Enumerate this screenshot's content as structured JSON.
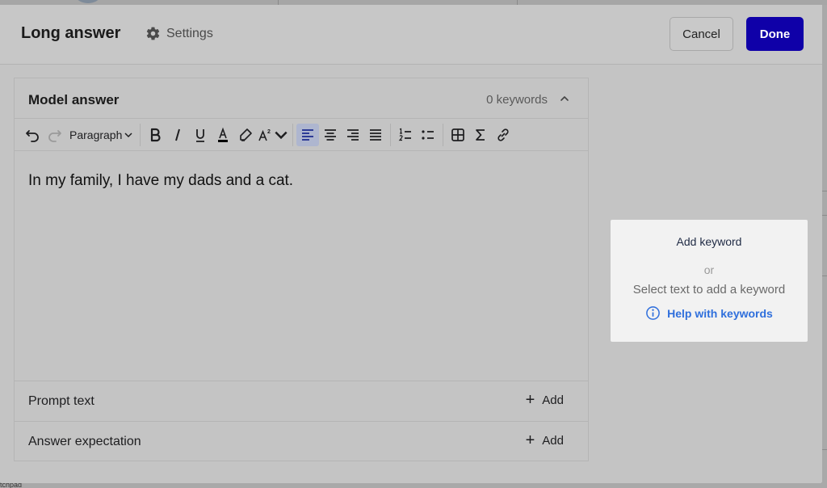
{
  "backdrop": {
    "bottom_text": "tchpad"
  },
  "header": {
    "title": "Long answer",
    "settings_label": "Settings",
    "cancel_label": "Cancel",
    "done_label": "Done"
  },
  "model_answer": {
    "title": "Model answer",
    "keyword_count": "0 keywords",
    "toolbar": {
      "block_format": "Paragraph",
      "superscript_label": "2"
    },
    "content": "In my family, I have my dads and a cat."
  },
  "rows": [
    {
      "label": "Prompt text",
      "add_label": "Add"
    },
    {
      "label": "Answer expectation",
      "add_label": "Add"
    }
  ],
  "keyword_card": {
    "add_keyword": "Add keyword",
    "or": "or",
    "select_text": "Select text to add a keyword",
    "help": "Help with keywords"
  },
  "colors": {
    "primary": "#0f00a8",
    "link": "#2f6fdc",
    "active_tool": "#aeb6cf"
  },
  "icons": [
    "gear-icon",
    "undo-icon",
    "redo-icon",
    "chevron-down-icon",
    "bold-icon",
    "italic-icon",
    "underline-icon",
    "font-color-icon",
    "highlight-icon",
    "superscript-icon",
    "align-left-icon",
    "align-center-icon",
    "align-right-icon",
    "align-justify-icon",
    "numbered-list-icon",
    "bullet-list-icon",
    "table-icon",
    "sigma-icon",
    "link-icon",
    "plus-icon",
    "info-icon",
    "chevron-up-icon"
  ]
}
